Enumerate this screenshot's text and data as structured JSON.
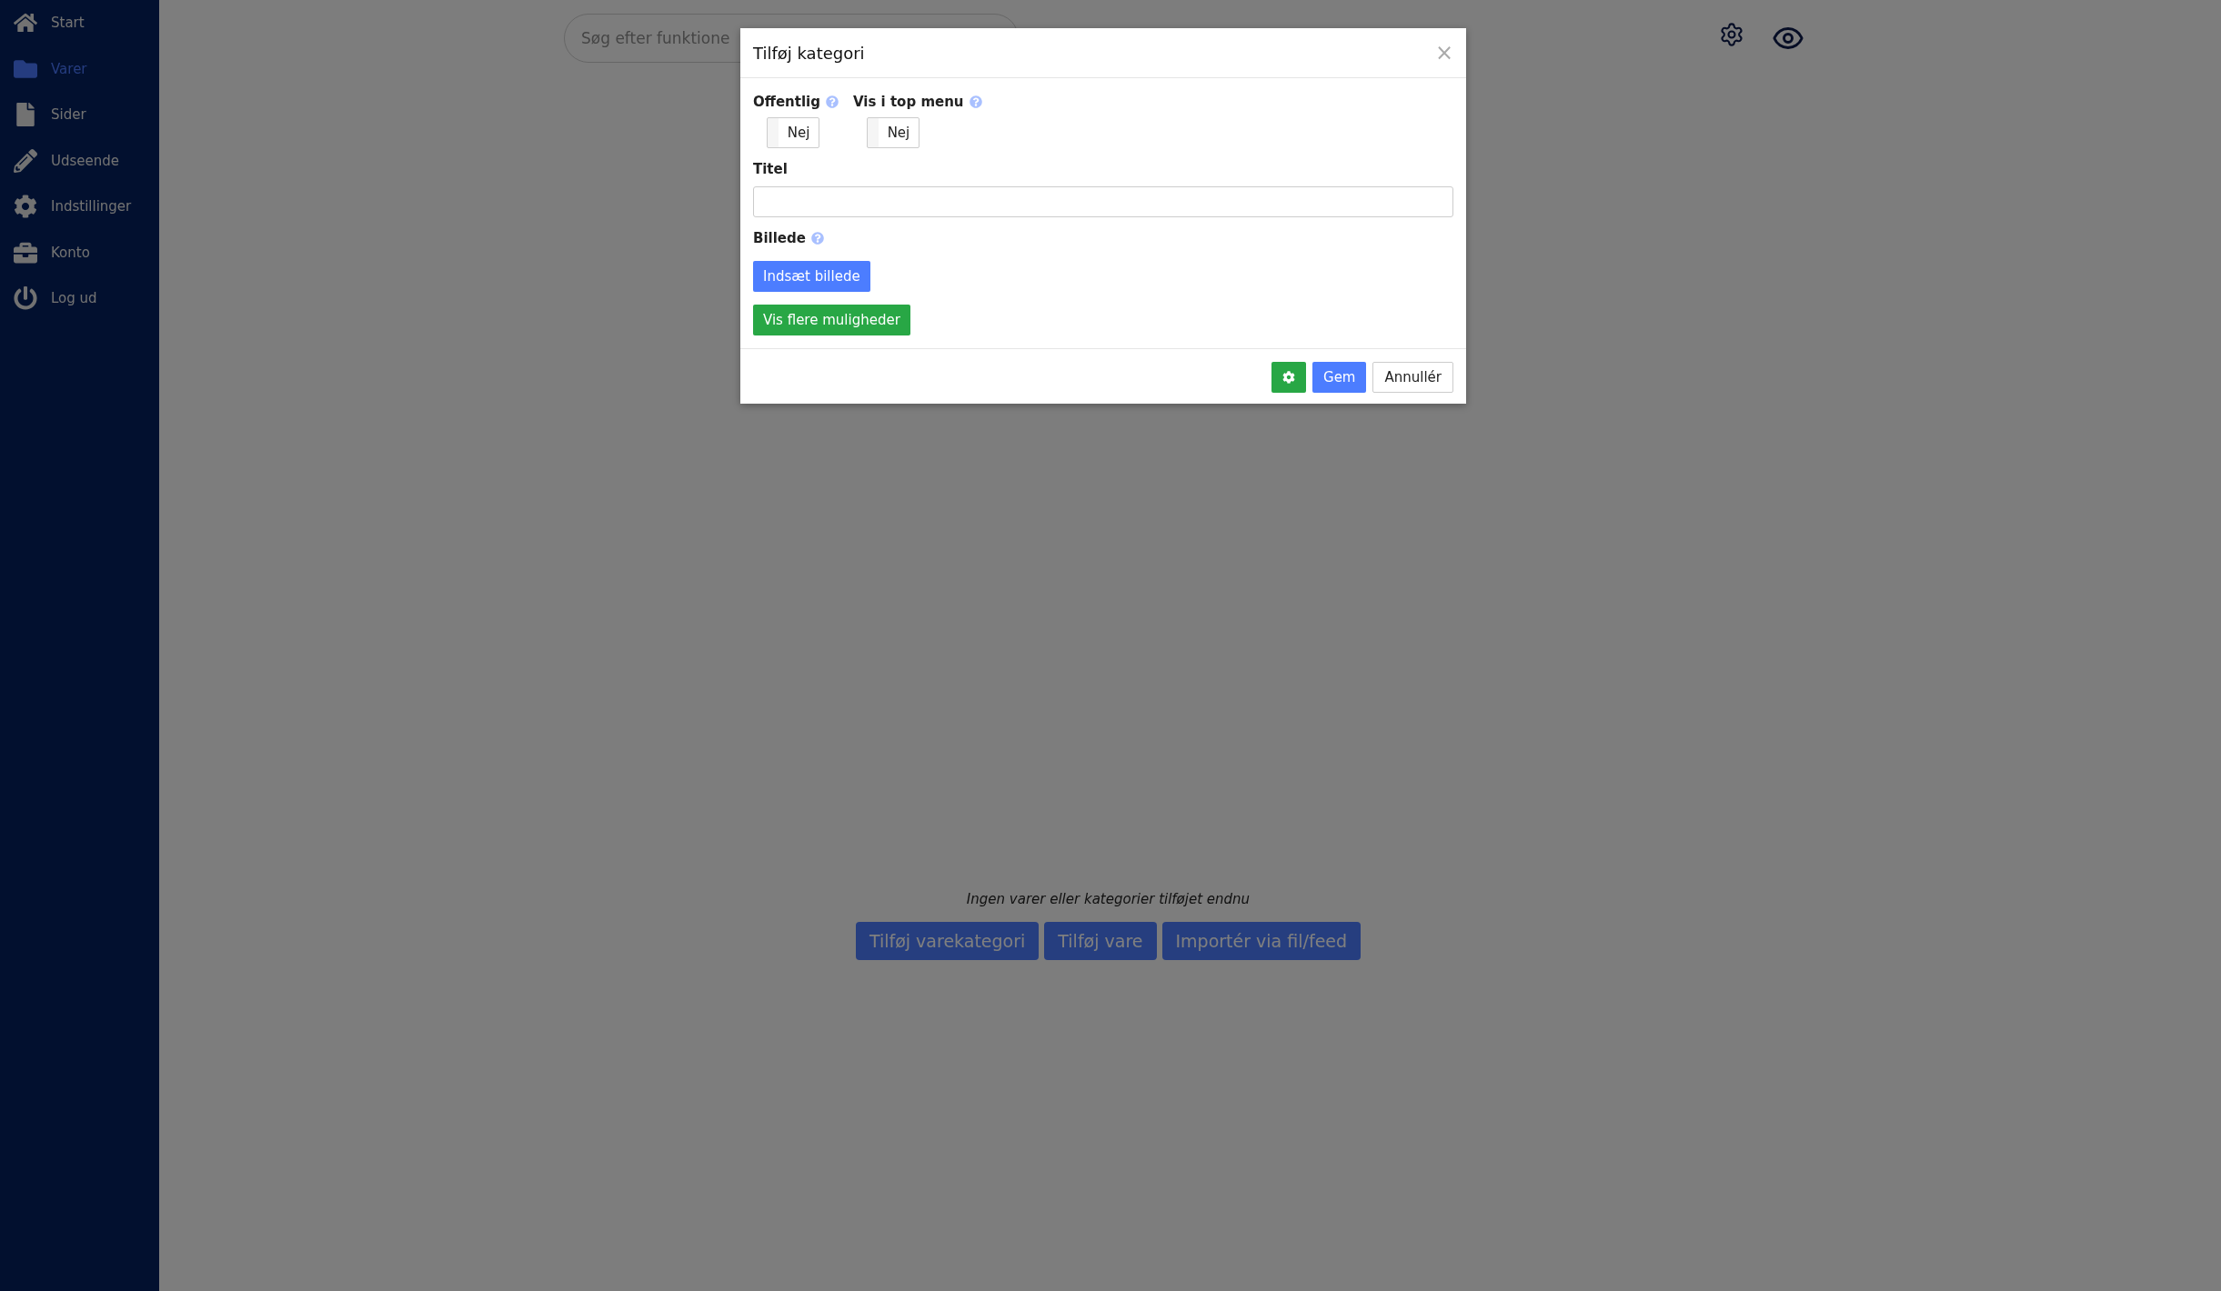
{
  "sidebar": {
    "items": [
      {
        "label": "Start",
        "selected": false
      },
      {
        "label": "Varer",
        "selected": true
      },
      {
        "label": "Sider",
        "selected": false
      },
      {
        "label": "Udseende",
        "selected": false
      },
      {
        "label": "Indstillinger",
        "selected": false
      },
      {
        "label": "Konto",
        "selected": false
      },
      {
        "label": "Log ud",
        "selected": false
      }
    ]
  },
  "search": {
    "placeholder": "Søg efter funktione"
  },
  "empty_message": "Ingen varer eller kategorier tilføjet endnu",
  "actions": [
    "Tilføj varekategori",
    "Tilføj vare",
    "Importér via fil/feed"
  ],
  "dialog": {
    "title": "Tilføj kategori",
    "close": "×",
    "toggles": [
      {
        "label": "Offentlig",
        "value": "Nej",
        "on": false
      },
      {
        "label": "Vis i top menu",
        "value": "Nej",
        "on": false
      }
    ],
    "title_field": {
      "label": "Titel"
    },
    "image": {
      "label": "Billede",
      "button": "Indsæt billede"
    },
    "more_button": "Vis flere muligheder",
    "footer": {
      "save": "Gem",
      "cancel": "Annullér"
    }
  }
}
